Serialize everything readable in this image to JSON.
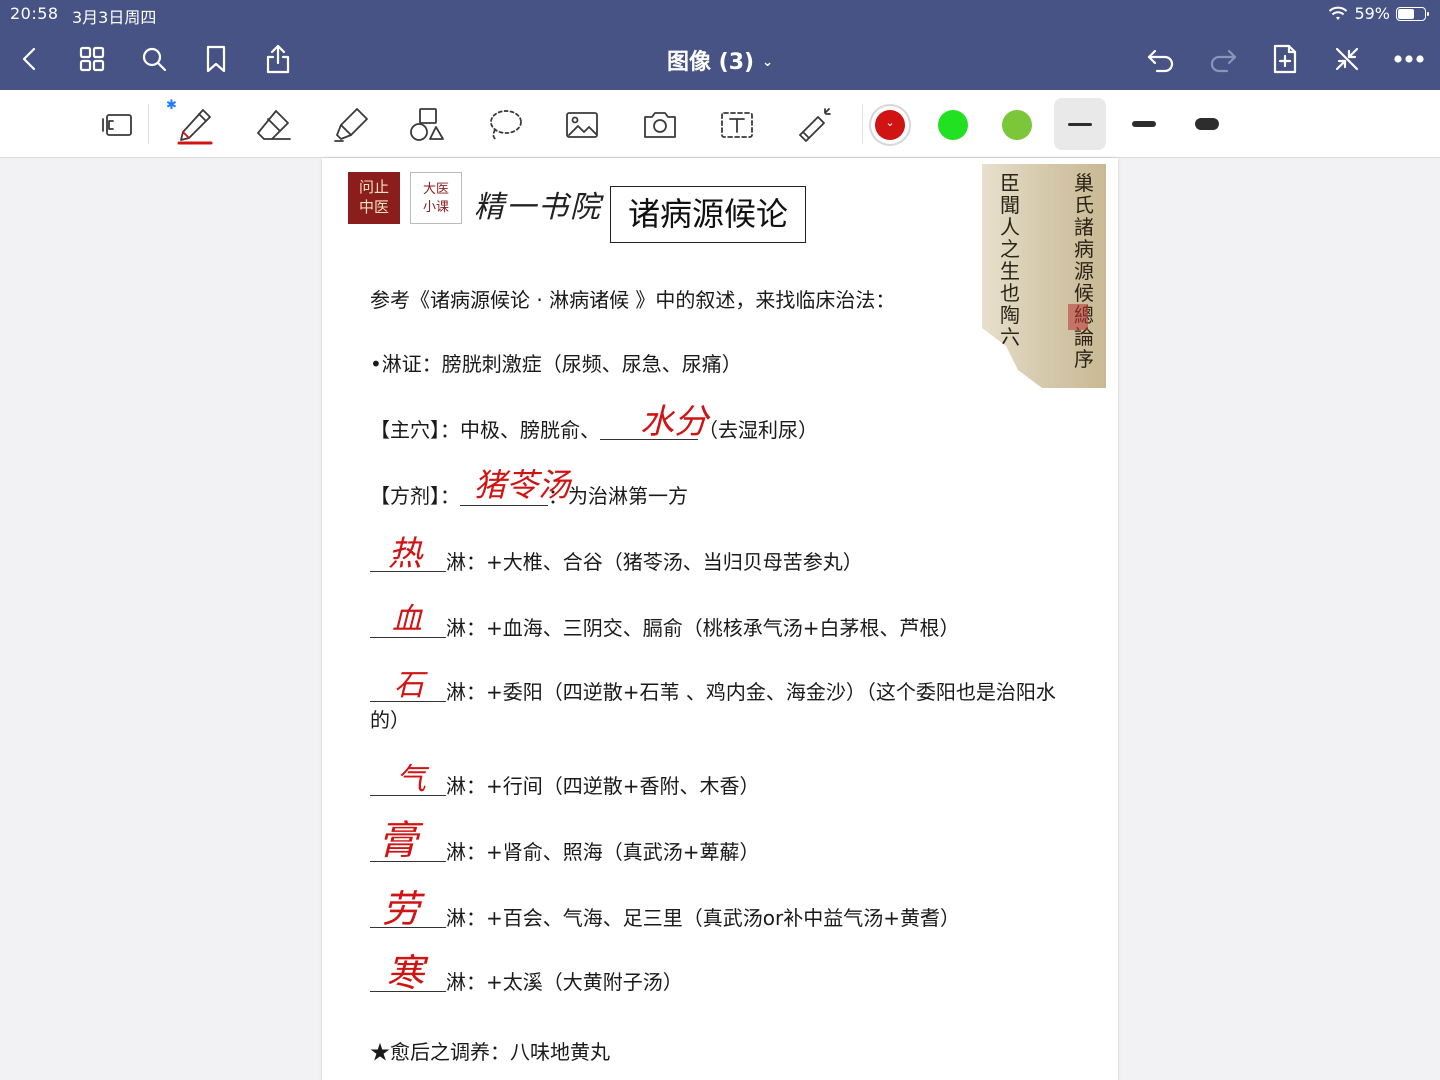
{
  "status_bar": {
    "time": "20:58",
    "date": "3月3日周四",
    "battery_text": "59%",
    "battery_level": 0.59
  },
  "nav": {
    "title": "图像 (3)",
    "buttons": [
      "back-icon",
      "grid-icon",
      "search-icon",
      "bookmark-icon",
      "share-icon",
      "undo-icon",
      "redo-icon",
      "add-page-icon",
      "close-fullscreen-icon",
      "more-icon"
    ]
  },
  "toolbar": {
    "tools": [
      "pen-tool",
      "eraser-tool",
      "highlighter-tool",
      "shapes-tool",
      "lasso-tool",
      "image-tool",
      "camera-tool",
      "text-tool",
      "laser-pointer-tool"
    ],
    "selected_tool": "pen-tool",
    "colors": [
      "#d01414",
      "#22e022",
      "#7cc63a"
    ],
    "selected_color": "#d01414",
    "thicknesses": [
      "thin",
      "medium",
      "thick"
    ],
    "selected_thickness": "thin"
  },
  "document": {
    "logo1": "问止\n中医",
    "logo2": "大医\n小课",
    "brand": "精一书院",
    "title": "诸病源候论",
    "scroll_col1": "巢氏諸病源候總論序",
    "scroll_col2": "臣聞人之生也陶六",
    "intro": "参考《诸病源候论 · 淋病诸候 》中的叙述，来找临床治法：",
    "bullet": "•淋证：膀胱刺激症（尿频、尿急、尿痛）",
    "main_points_prefix": "【主穴】：中极、膀胱俞、",
    "main_points_suffix": "（去湿利尿）",
    "main_points_hw": "水分",
    "formula_prefix": "【方剂】：",
    "formula_suffix": "：为治淋第一方",
    "formula_hw": "猪苓汤",
    "items": [
      {
        "hw": "热",
        "text": "淋：+大椎、合谷（猪苓汤、当归贝母苦参丸）"
      },
      {
        "hw": "血",
        "text": "淋：+血海、三阴交、膈俞（桃核承气汤+白茅根、芦根）"
      },
      {
        "hw": "石",
        "text": "淋：+委阳（四逆散+石苇 、鸡内金、海金沙）（这个委阳也是治阳水"
      },
      {
        "hw": "气",
        "text": "淋：+行间（四逆散+香附、木香）"
      },
      {
        "hw": "膏",
        "text": "淋：+肾俞、照海（真武汤+萆薢）"
      },
      {
        "hw": "劳",
        "text": "淋：+百会、气海、足三里（真武汤or补中益气汤+黄耆）"
      },
      {
        "hw": "寒",
        "text": "淋：+太溪（大黄附子汤）"
      }
    ],
    "stone_continuation": "的）",
    "footer": "★愈后之调养：八味地黄丸"
  }
}
